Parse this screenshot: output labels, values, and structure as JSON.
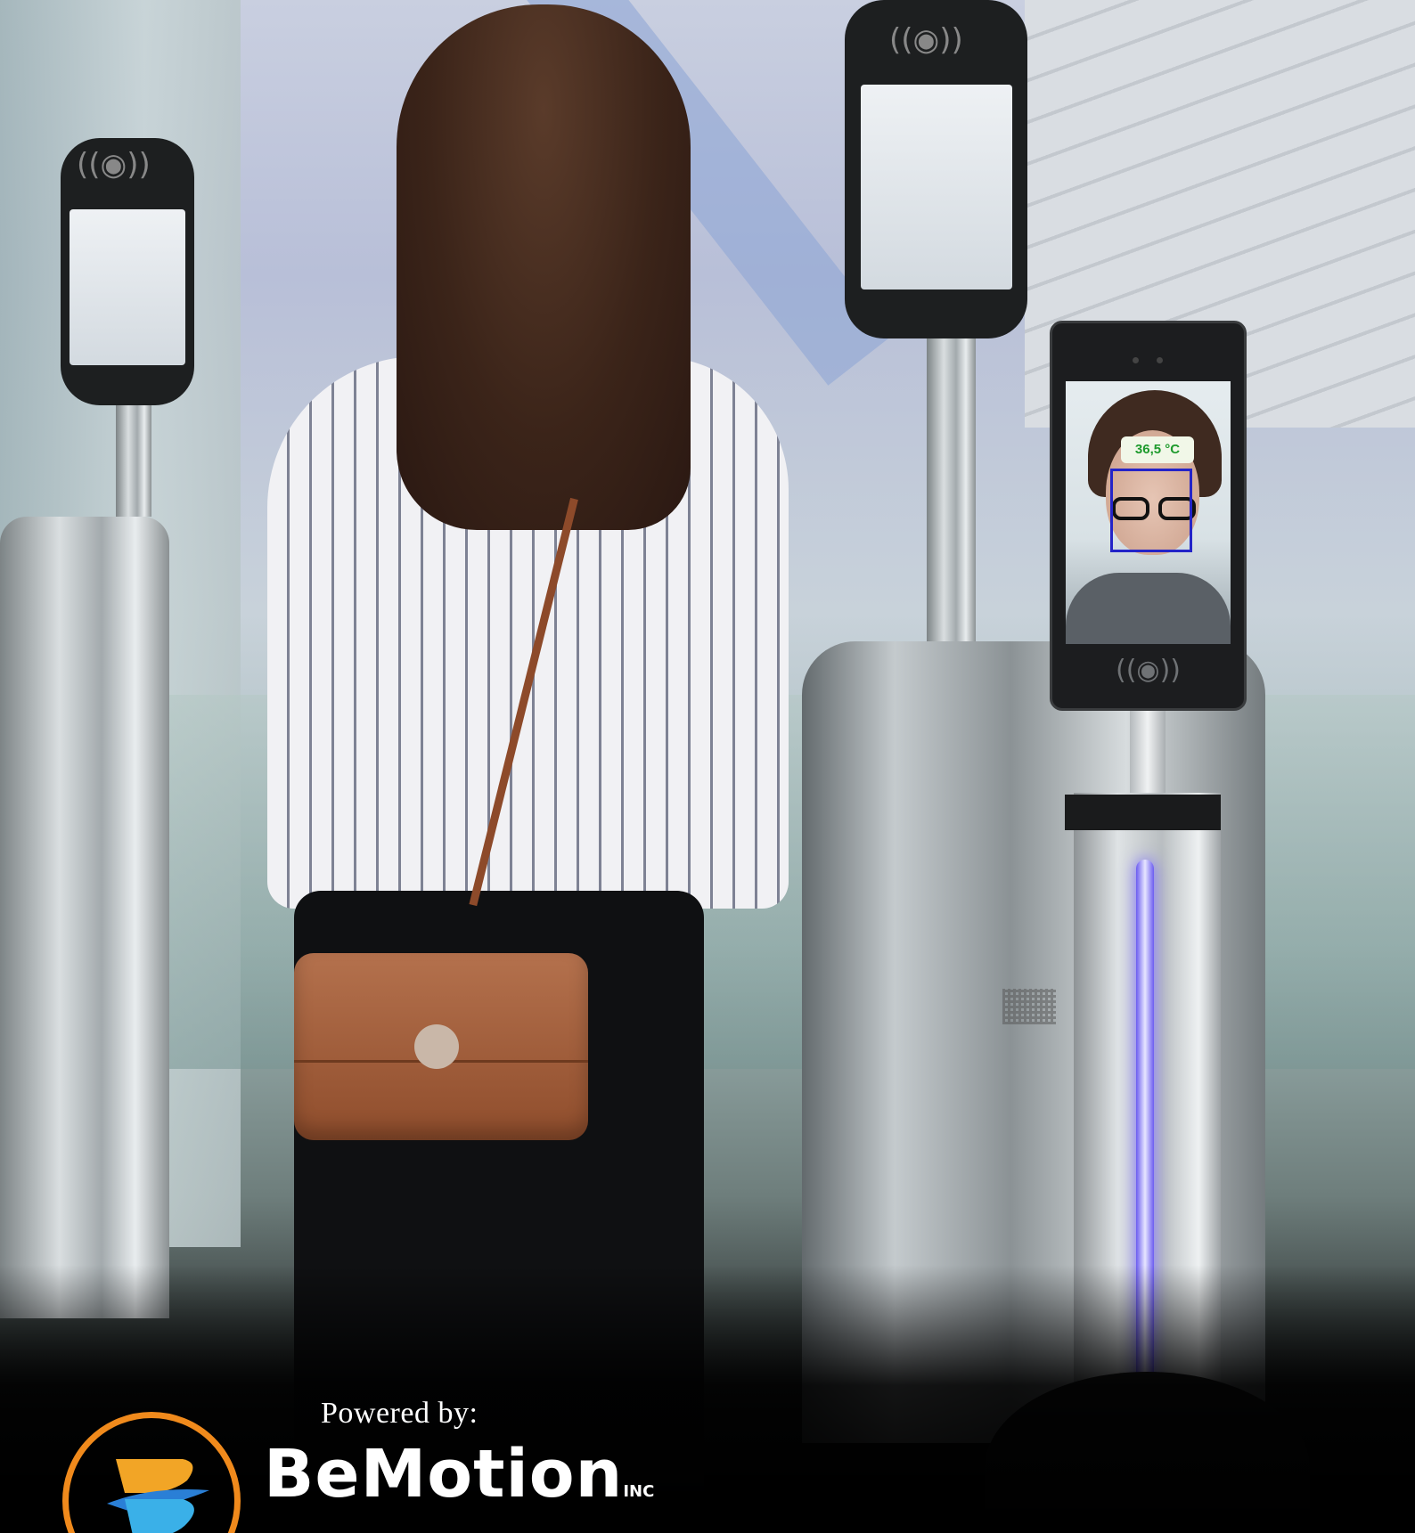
{
  "scene": {
    "temperature_reading": "36,5 °C",
    "powered_by_label": "Powered by:",
    "brand_name": "BeMotion",
    "brand_suffix": "INC",
    "colors": {
      "brand_orange": "#f08a1c",
      "brand_blue": "#2a7fd6",
      "temperature_green": "#1d9a2c",
      "face_box_blue": "#2424c8",
      "led_purple": "#6b5cf0"
    }
  }
}
